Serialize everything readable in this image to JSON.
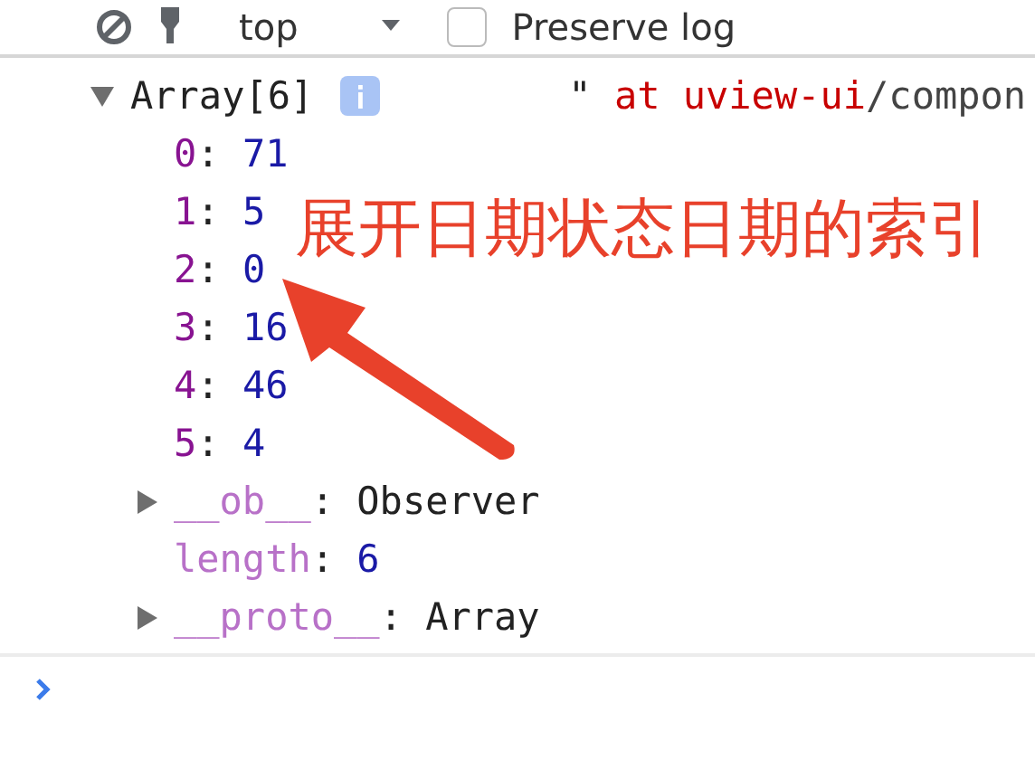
{
  "toolbar": {
    "context": "top",
    "preserve_log": {
      "label": "Preserve log",
      "checked": false
    }
  },
  "console": {
    "entry": {
      "label": "Array[6]",
      "expanded": true,
      "source_quote": "\"",
      "source_parts": [
        {
          "text": "at uview-ui",
          "kind": "link"
        },
        {
          "text": "/compon",
          "kind": "plain"
        }
      ],
      "children": [
        {
          "kind": "index",
          "key": "0",
          "sep": ":",
          "value": "71"
        },
        {
          "kind": "index",
          "key": "1",
          "sep": ":",
          "value": "5"
        },
        {
          "kind": "index",
          "key": "2",
          "sep": ":",
          "value": "0"
        },
        {
          "kind": "index",
          "key": "3",
          "sep": ":",
          "value": "16"
        },
        {
          "kind": "index",
          "key": "4",
          "sep": ":",
          "value": "46"
        },
        {
          "kind": "index",
          "key": "5",
          "sep": ":",
          "value": "4"
        },
        {
          "kind": "object",
          "key": "__ob__",
          "sep": ":",
          "value": "Observer",
          "expanded": false
        },
        {
          "kind": "property",
          "key": "length",
          "sep": ":",
          "value": "6"
        },
        {
          "kind": "object",
          "key": "__proto__",
          "sep": ":",
          "value": "Array",
          "expanded": false
        }
      ]
    }
  },
  "annotation": {
    "text": "展开日期状态日期的索引"
  }
}
